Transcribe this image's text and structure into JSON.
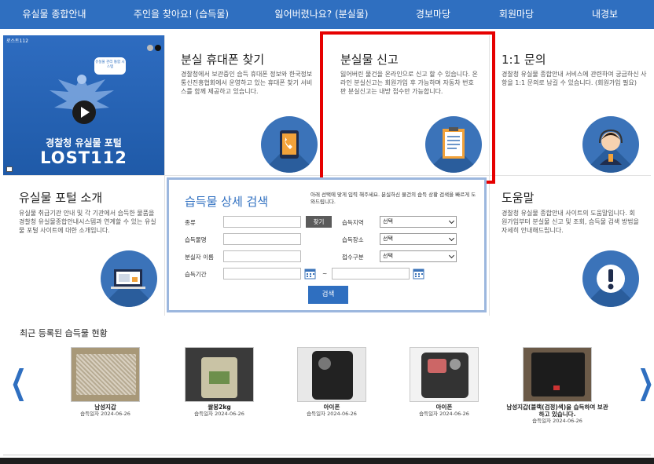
{
  "nav": {
    "items": [
      {
        "label": "유실물 종합안내"
      },
      {
        "label": "주인을 찾아요! (습득물)"
      },
      {
        "label": "잃어버렸나요? (분실물)"
      },
      {
        "label": "경보마당"
      },
      {
        "label": "회원마당"
      },
      {
        "label": "내경보"
      }
    ]
  },
  "video": {
    "tag": "로스트112",
    "bubble": "유실물 관리 통합 시스템",
    "title1": "경찰청 유실물 포털",
    "title2": "LOST112"
  },
  "cards": {
    "phone": {
      "title": "분실 휴대폰 찾기",
      "desc": "경찰청에서 보관중인 습득 휴대폰 정보와 한국정보통신진흥협회에서 운영하고 있는 휴대폰 찾기 서비스를 함께 제공하고 있습니다.",
      "icon": "phone-icon"
    },
    "report": {
      "title": "분실물 신고",
      "desc": "잃어버린 물건을 온라인으로 신고 할 수 있습니다. 온라인 분실신고는 회원가입 후 가능하며 자동차 번호판 분실신고는 내방 접수만 가능합니다.",
      "icon": "clipboard-icon"
    },
    "inquiry": {
      "title": "1:1 문의",
      "desc": "경찰청 유실물 종합안내 서비스에 관련하여 궁금하신 사항을 1:1 문의로 남길 수 있습니다. (회원가입 필요)",
      "icon": "operator-icon"
    },
    "portal": {
      "title": "유실물 포털 소개",
      "desc": "유실물 취급기관 안내 및 각 기관에서 습득한 물품을 경찰청 유실물종합안내시스템과 연계할 수 있는 유실물 포털 사이트에 대한 소개입니다.",
      "icon": "monitor-icon"
    },
    "help": {
      "title": "도움말",
      "desc": "경찰청 유실물 종합안내 사이트의 도움말입니다. 회원가입부터 분실물 신고 및 조회, 습득물 검색 방법을 자세히 안내해드립니다.",
      "icon": "exclamation-icon"
    }
  },
  "search": {
    "title": "습득물 상세 검색",
    "note": "아래 선택에 맞게 입력 해주세요. 분실하신 물건의 습득 상황 검색을 빠르게 도와드립니다.",
    "labels": {
      "category": "종류",
      "item_name": "습득물명",
      "loser_name": "분실자 이름",
      "period": "습득기간",
      "region": "습득지역",
      "place": "습득장소",
      "receipt_type": "접수구분"
    },
    "find_button": "찾기",
    "select_default": "선택",
    "tilde": "~",
    "submit": "검색"
  },
  "recent": {
    "title": "최근 등록된 습득물 현황",
    "prev": "❮",
    "next": "❯",
    "items": [
      {
        "name": "남성지갑",
        "date": "습득일자 2024-06-26"
      },
      {
        "name": "쌀봉2kg",
        "date": "습득일자 2024-06-26"
      },
      {
        "name": "아이폰",
        "date": "습득일자 2024-06-26"
      },
      {
        "name": "아이폰",
        "date": "습득일자 2024-06-26"
      },
      {
        "name": "남성지갑(블랙(검정)색)을 습득하여 보관하고 있습니다.",
        "date": "습득일자 2024-06-26"
      }
    ]
  },
  "colors": {
    "brand_blue": "#2f6fc0",
    "highlight_red": "#e60000",
    "search_border": "#9cb7de"
  }
}
